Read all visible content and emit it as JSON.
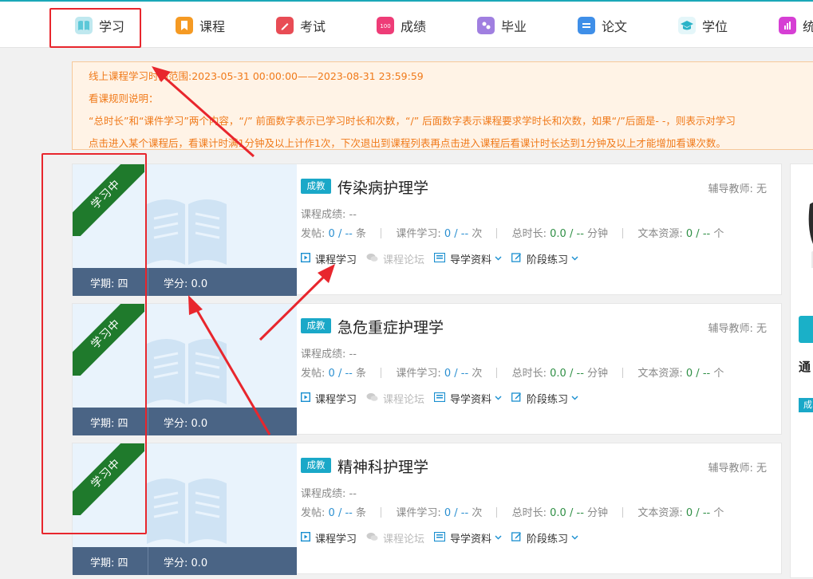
{
  "nav": {
    "items": [
      {
        "label": "学习",
        "icon": "book-icon",
        "color": "#5cc8d8"
      },
      {
        "label": "课程",
        "icon": "bookmark-icon",
        "color": "#f59a23"
      },
      {
        "label": "考试",
        "icon": "pen-icon",
        "color": "#e84c55"
      },
      {
        "label": "成绩",
        "icon": "score-100-icon",
        "color": "#ee3c77"
      },
      {
        "label": "毕业",
        "icon": "graduate-icon",
        "color": "#a07fe0"
      },
      {
        "label": "论文",
        "icon": "document-icon",
        "color": "#3f8fe8"
      },
      {
        "label": "学位",
        "icon": "cap-icon",
        "color": "#2ab3c8"
      },
      {
        "label": "统",
        "icon": "stats-icon",
        "color": "#d63fd4"
      }
    ]
  },
  "notice": {
    "line1": "线上课程学习时间范围:2023-05-31 00:00:00——2023-08-31 23:59:59",
    "line2": "看课规则说明：",
    "line3": "“总时长”和“课件学习”两个内容，“/” 前面数字表示已学习时长和次数，“/” 后面数字表示课程要求学时长和次数，如果“/”后面是- -，则表示对学习",
    "line4": "点击进入某个课程后，看课计时满1分钟及以上计作1次，下次退出到课程列表再点击进入课程后看课计时长达到1分钟及以上才能增加看课次数。"
  },
  "labels": {
    "ribbon": "学习中",
    "term": "学期: 四",
    "credit": "学分: 0.0",
    "tag": "成教",
    "tutor": "辅导教师: 无",
    "score": "课程成绩: --",
    "posts": "发帖:",
    "courseware": "课件学习:",
    "total_time": "总时长:",
    "text_resource": "文本资源:",
    "unit_item": "条",
    "unit_times": "次",
    "unit_minutes": "分钟",
    "unit_count": "个",
    "zero": "0",
    "zero_decimal": "0.0",
    "slash": "/",
    "dashes": "--",
    "action_study": "课程学习",
    "action_forum": "课程论坛",
    "action_guide": "导学资料",
    "action_practice": "阶段练习"
  },
  "courses": [
    {
      "name": "传染病护理学"
    },
    {
      "name": "急危重症护理学"
    },
    {
      "name": "精神科护理学"
    }
  ],
  "right": {
    "title": "通",
    "tag": "成"
  }
}
